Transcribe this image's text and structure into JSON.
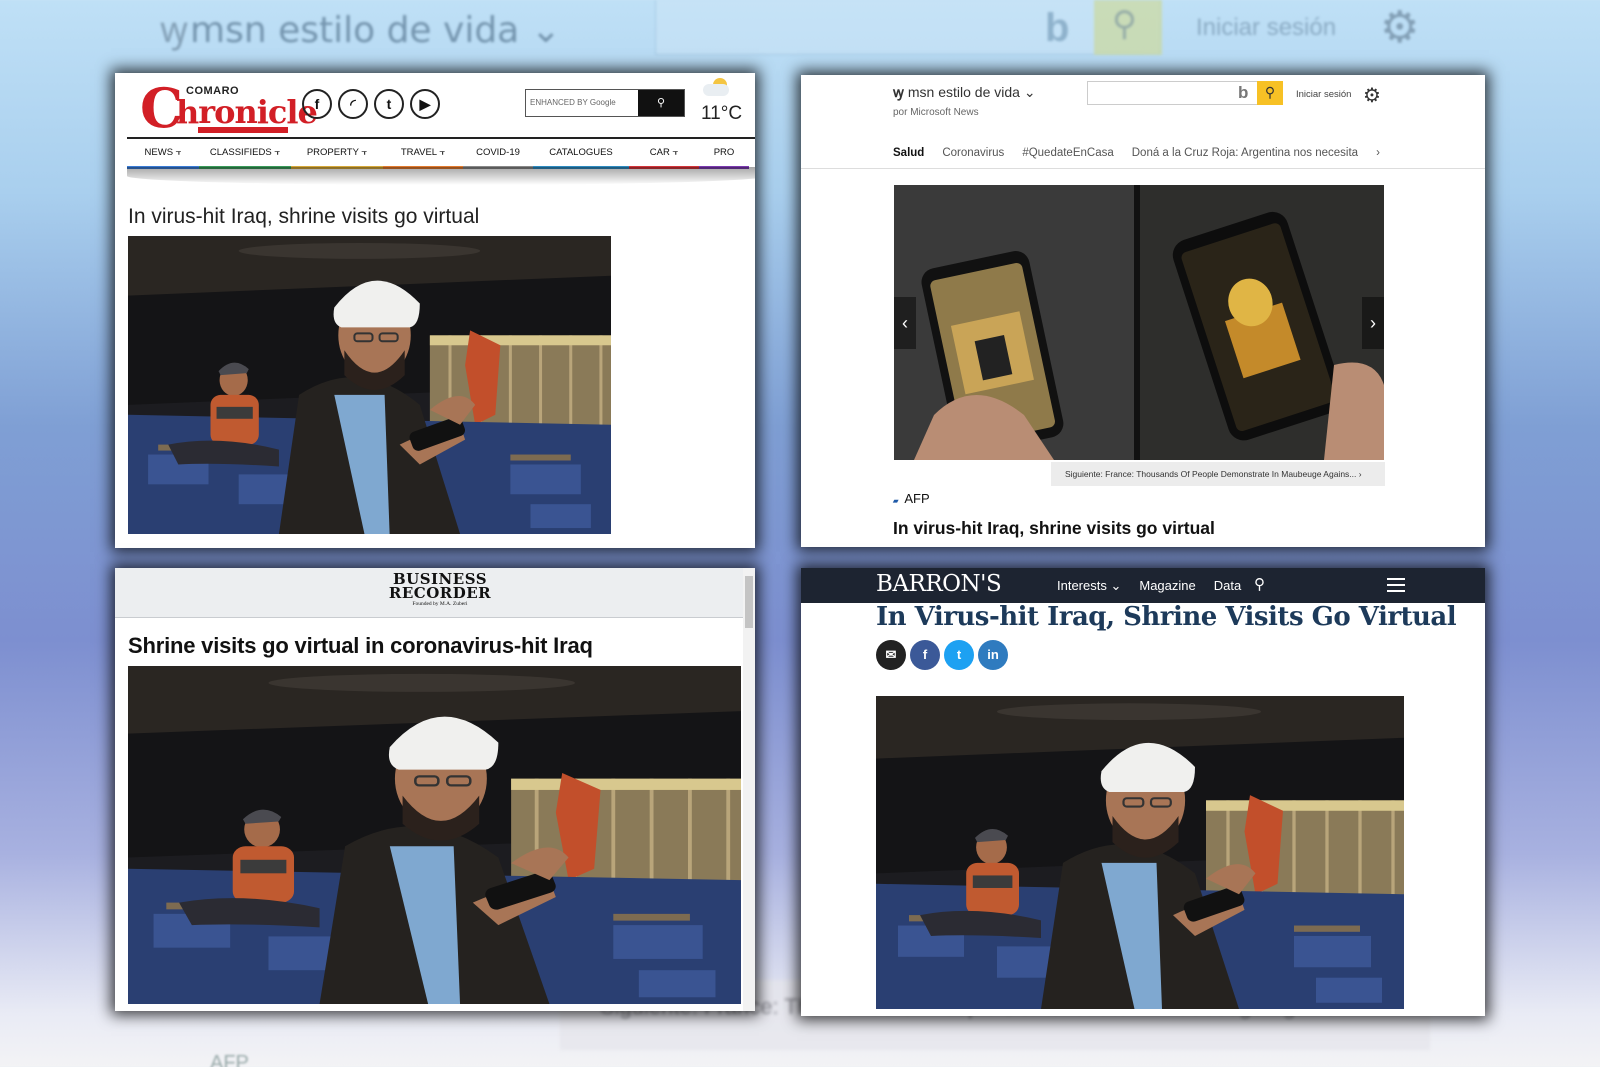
{
  "background": {
    "msn_title": "msn estilo de vida",
    "signin": "Iniciar sesión",
    "siguiente": "Siguiente: France: Thousands Of People Demonstrate In Maubeuge Agains...",
    "afp": "AFP"
  },
  "chronicle": {
    "logo_top": "COMARO",
    "logo_c": "C",
    "logo_rest": "hronicle",
    "search_placeholder": "ENHANCED BY Google",
    "temperature": "11°C",
    "nav": [
      "NEWS",
      "CLASSIFIEDS",
      "PROPERTY",
      "TRAVEL",
      "COVID-19",
      "CATALOGUES",
      "CAR",
      "PRO"
    ],
    "nav_colors": [
      "#3a7bd5",
      "#3a9b5a",
      "#d5a83a",
      "#e17a2e",
      "#888888",
      "#2e8bc0",
      "#d2343a",
      "#7b3ab0"
    ],
    "headline": "In virus-hit Iraq, shrine visits go virtual"
  },
  "msn": {
    "logo": "msn estilo de vida",
    "sub": "por Microsoft News",
    "signin": "Iniciar sesión",
    "nav": [
      "Salud",
      "Coronavirus",
      "#QuedateEnCasa",
      "Doná a la Cruz Roja: Argentina nos necesita"
    ],
    "next": "Siguiente: France: Thousands Of People Demonstrate In Maubeuge Agains...",
    "source": "AFP",
    "headline": "In virus-hit Iraq, shrine visits go virtual"
  },
  "business_recorder": {
    "logo_line1": "BUSINESS",
    "logo_line2": "RECORDER",
    "tagline": "Founded by M.A. Zuberi",
    "headline": "Shrine visits go virtual in coronavirus-hit Iraq"
  },
  "barrons": {
    "logo": "BARRON'S",
    "nav": [
      "Interests",
      "Magazine",
      "Data"
    ],
    "headline": "In Virus-hit Iraq, Shrine Visits Go Virtual",
    "share_colors": [
      "#222222",
      "#3b5998",
      "#1da1f2",
      "#2f7bbf"
    ]
  }
}
